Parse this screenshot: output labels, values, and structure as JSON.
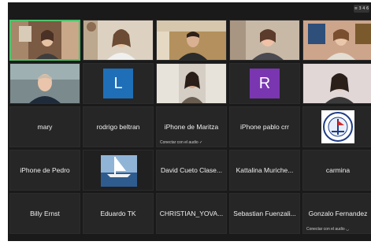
{
  "window": {
    "share_label": "≡ 3 4 6"
  },
  "participants": [
    {
      "name": "",
      "type": "video",
      "active": true
    },
    {
      "name": "",
      "type": "video"
    },
    {
      "name": "",
      "type": "video"
    },
    {
      "name": "",
      "type": "video"
    },
    {
      "name": "",
      "type": "video"
    },
    {
      "name": "",
      "type": "video"
    },
    {
      "name": "",
      "type": "letter",
      "letter": "L",
      "color": "#1e6fb8"
    },
    {
      "name": "",
      "type": "video"
    },
    {
      "name": "",
      "type": "letter",
      "letter": "R",
      "color": "#7a36b1"
    },
    {
      "name": "",
      "type": "video"
    },
    {
      "name": "mary",
      "type": "name"
    },
    {
      "name": "rodrigo beltran",
      "type": "name"
    },
    {
      "name": "iPhone de Maritza",
      "type": "name",
      "audio_note": "Conectar con el audio ✓"
    },
    {
      "name": "iPhone pablo crr",
      "type": "name"
    },
    {
      "name": "",
      "type": "logo",
      "logo_text": "YACHTING CLUB"
    },
    {
      "name": "iPhone de Pedro",
      "type": "name"
    },
    {
      "name": "",
      "type": "image"
    },
    {
      "name": "David Cueto Clase...",
      "type": "name"
    },
    {
      "name": "Kattalina Muriche...",
      "type": "name"
    },
    {
      "name": "carmina",
      "type": "name"
    },
    {
      "name": "Billy Ernst",
      "type": "name"
    },
    {
      "name": "Eduardo TK",
      "type": "name"
    },
    {
      "name": "CHRISTIAN_YOVA...",
      "type": "name"
    },
    {
      "name": "Sebastian Fuenzali...",
      "type": "name"
    },
    {
      "name": "Gonzalo Fernandez",
      "type": "name",
      "audio_note": "Conectar con el audio ◡"
    }
  ]
}
